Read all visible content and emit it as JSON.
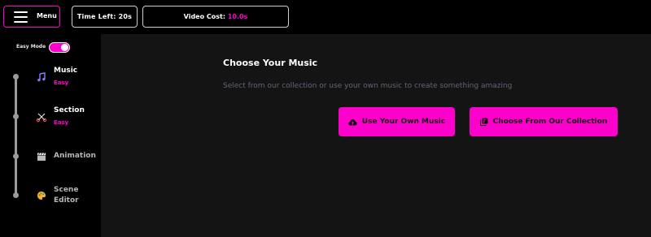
{
  "topbar": {
    "menu_label": "Menu",
    "time_left_label": "Time Left:",
    "time_left_value": "20s",
    "video_cost_label": "Video Cost:",
    "video_cost_value": "10.0s"
  },
  "sidebar": {
    "easy_mode_label": "Easy Mode",
    "easy_mode_on": true,
    "steps": [
      {
        "title": "Music",
        "subtitle": "Easy",
        "icon": "music-note-icon"
      },
      {
        "title": "Section",
        "subtitle": "Easy",
        "icon": "scissors-icon"
      },
      {
        "title": "Animation",
        "subtitle": "",
        "icon": "clapperboard-icon"
      },
      {
        "title_line1": "Scene",
        "title_line2": "Editor",
        "subtitle": "",
        "icon": "palette-icon"
      }
    ]
  },
  "main": {
    "title": "Choose Your Music",
    "description": "Select from our collection or use your own music to create something amazing",
    "own_music_button": "Use Your Own Music",
    "collection_button": "Choose From Our Collection"
  },
  "colors": {
    "accent": "#ff00cc",
    "background": "#141414",
    "sidebar": "#000000"
  }
}
